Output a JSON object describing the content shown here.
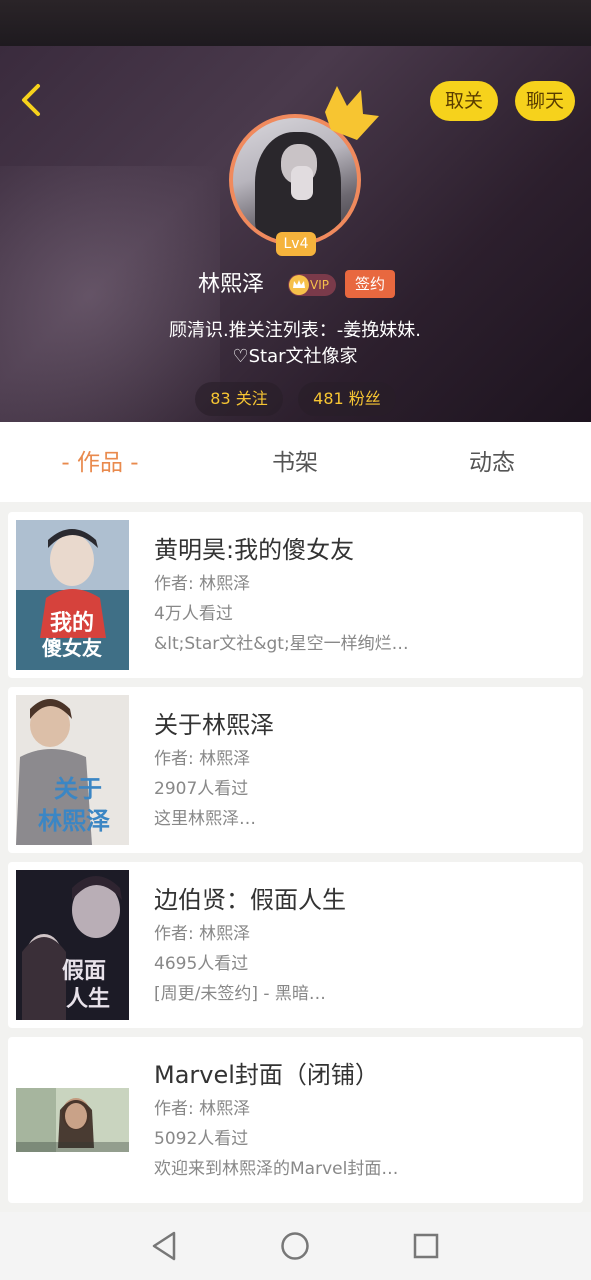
{
  "profile": {
    "username": "林熙泽",
    "level": "Lv4",
    "vip_label": "VIP",
    "sign_label": "签约",
    "bio_line1": "顾清识.推关注列表：-姜挽妹妹.",
    "bio_line2": "♡Star文社像家",
    "following": "83 关注",
    "fans": "481 粉丝"
  },
  "header": {
    "unfollow_label": "取关",
    "chat_label": "聊天"
  },
  "tabs": [
    "- 作品 -",
    "书架",
    "动态"
  ],
  "books": [
    {
      "title": "黄明昊:我的傻女友",
      "author": "作者: 林熙泽",
      "views": "4万人看过",
      "desc": "&lt;Star文社&gt;星空一样绚烂…",
      "cover_text": "我的傻女友"
    },
    {
      "title": "关于林熙泽",
      "author": "作者: 林熙泽",
      "views": "2907人看过",
      "desc": "这里林熙泽…",
      "cover_text": "关于林熙泽"
    },
    {
      "title": "边伯贤：假面人生",
      "author": "作者: 林熙泽",
      "views": "4695人看过",
      "desc": "[周更/未签约] - 黑暗…",
      "cover_text": "假面人生"
    },
    {
      "title": "Marvel封面（闭铺）",
      "author": "作者: 林熙泽",
      "views": "5092人看过",
      "desc": "欢迎来到林熙泽的Marvel封面…",
      "cover_text": ""
    }
  ],
  "colors": {
    "accent_yellow": "#f6d21c",
    "accent_orange": "#e98a4d",
    "sign_badge": "#e8683f"
  }
}
